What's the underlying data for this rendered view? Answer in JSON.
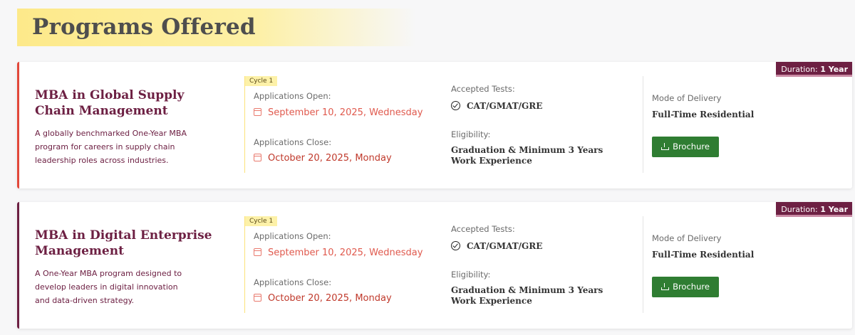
{
  "page": {
    "heading": "Programs Offered"
  },
  "programs": [
    {
      "duration_label": "Duration:",
      "duration_value": "1 Year",
      "title": "MBA in Global Supply Chain Management",
      "description": "A globally benchmarked One-Year MBA program for careers in supply chain leadership roles across industries.",
      "cycle": "Cycle 1",
      "applications_open_label": "Applications Open:",
      "applications_open_date": "September 10, 2025, Wednesday",
      "applications_close_label": "Applications Close:",
      "applications_close_date": "October 20, 2025, Monday",
      "accepted_tests_label": "Accepted Tests:",
      "accepted_tests": "CAT/GMAT/GRE",
      "eligibility_label": "Eligibility:",
      "eligibility": "Graduation & Minimum 3 Years Work Experience",
      "mode_label": "Mode of Delivery",
      "mode": "Full-Time Residential",
      "brochure_label": "Brochure",
      "accent_color": "#e2483a"
    },
    {
      "duration_label": "Duration:",
      "duration_value": "1 Year",
      "title": "MBA in Digital Enterprise Management",
      "description": "A One-Year MBA program designed to develop leaders in digital innovation and data-driven strategy.",
      "cycle": "Cycle 1",
      "applications_open_label": "Applications Open:",
      "applications_open_date": "September 10, 2025, Wednesday",
      "applications_close_label": "Applications Close:",
      "applications_close_date": "October 20, 2025, Monday",
      "accepted_tests_label": "Accepted Tests:",
      "accepted_tests": "CAT/GMAT/GRE",
      "eligibility_label": "Eligibility:",
      "eligibility": "Graduation & Minimum 3 Years Work Experience",
      "mode_label": "Mode of Delivery",
      "mode": "Full-Time Residential",
      "brochure_label": "Brochure",
      "accent_color": "#6d2043"
    }
  ],
  "icons": {
    "calendar": "calendar-icon",
    "check": "check-circle-icon",
    "download": "download-icon"
  },
  "colors": {
    "brand": "#6d2043",
    "button": "#2f7d32",
    "date": "#e05a4e",
    "heading_highlight": "#fde98a"
  }
}
